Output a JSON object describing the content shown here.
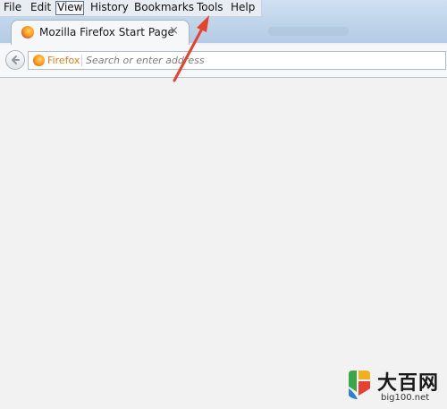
{
  "menubar": {
    "items": [
      "File",
      "Edit",
      "View",
      "History",
      "Bookmarks",
      "Tools",
      "Help"
    ],
    "active_item": "View"
  },
  "tab": {
    "title": "Mozilla Firefox Start Page",
    "close_glyph": "×"
  },
  "navbar": {
    "identity_label": "Firefox",
    "url_placeholder": "Search or enter address",
    "url_value": ""
  },
  "colors": {
    "identity": "#e07a1c",
    "annotation_arrow": "#e8412c",
    "content_background": "#f2f2f2"
  },
  "watermark": {
    "title": "大百网",
    "url": "big100.net"
  }
}
